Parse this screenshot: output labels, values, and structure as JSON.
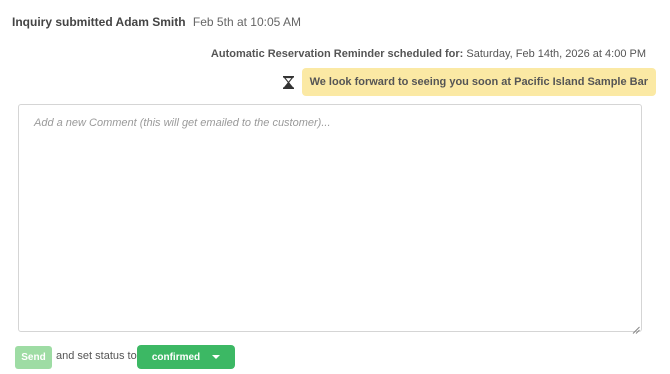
{
  "inquiry": {
    "label": "Inquiry submitted Adam Smith",
    "date": "Feb 5th at 10:05 AM"
  },
  "reminder": {
    "label": "Automatic Reservation Reminder scheduled for:",
    "value": "Saturday, Feb 14th, 2026 at 4:00 PM"
  },
  "message": {
    "icon": "hourglass-icon",
    "text": "We look forward to seeing you soon at Pacific Island Sample Bar"
  },
  "comment": {
    "placeholder": "Add a new Comment (this will get emailed to the customer)...",
    "value": ""
  },
  "actions": {
    "send_label": "Send",
    "status_text": "and set status to",
    "status_value": "confirmed"
  },
  "colors": {
    "bubble": "#fbe9a4",
    "send_button": "#9edca4",
    "status_dropdown": "#3cb864"
  }
}
